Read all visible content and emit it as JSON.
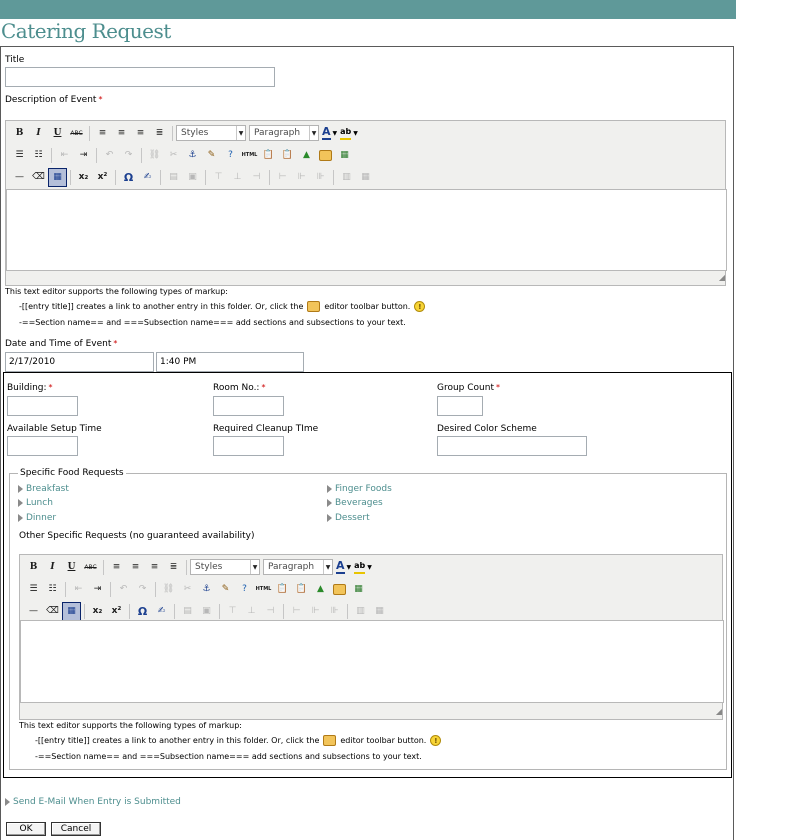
{
  "page": {
    "title": "Catering Request"
  },
  "fields": {
    "title_label": "Title",
    "title_value": "",
    "description_label": "Description of Event",
    "date_label": "Date and Time of Event",
    "date_value": "2/17/2010",
    "time_value": "1:40 PM",
    "building_label": "Building:",
    "room_label": "Room No.:",
    "group_count_label": "Group Count",
    "setup_label": "Available Setup Time",
    "cleanup_label": "Required Cleanup TIme",
    "color_label": "Desired Color Scheme",
    "required_mark": "*"
  },
  "editor": {
    "styles": "Styles",
    "paragraph": "Paragraph",
    "bold": "B",
    "italic": "I",
    "underline": "U",
    "strike": "ABC",
    "html": "HTML",
    "omega": "Ω",
    "font_color": "A",
    "highlight": "ab"
  },
  "help": {
    "intro": "This text editor supports the following types of markup:",
    "link_before": "-[[entry title]] creates a link to another entry in this folder. Or, click the",
    "link_after": "editor toolbar button.",
    "sections": "-==Section name== and ===Subsection name=== add sections and subsections to your text."
  },
  "food": {
    "legend": "Specific Food Requests",
    "left": [
      "Breakfast",
      "Lunch",
      "Dinner"
    ],
    "right": [
      "Finger Foods",
      "Beverages",
      "Dessert"
    ],
    "other_label": "Other Specific Requests (no guaranteed availability)"
  },
  "footer": {
    "email_link": "Send E-Mail When Entry is Submitted",
    "ok": "OK",
    "cancel": "Cancel"
  },
  "colors": {
    "topbar": "#5f9999",
    "title": "#4d8e8e",
    "link": "#4d8e8e",
    "required": "#cc0000"
  }
}
